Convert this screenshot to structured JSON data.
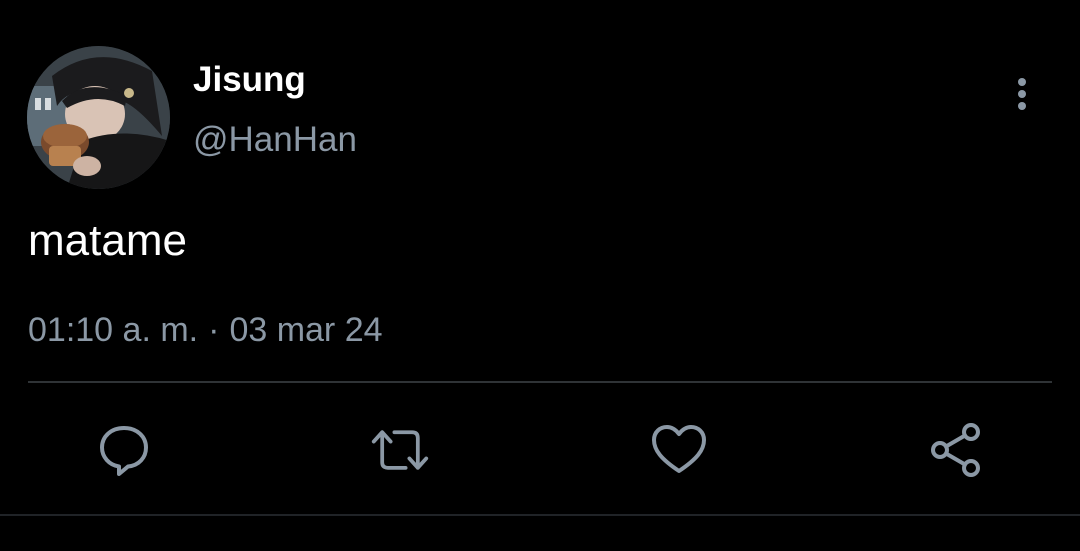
{
  "author": {
    "display_name": "Jisung",
    "handle": "@HanHan",
    "avatar_icon": "profile-photo"
  },
  "tweet": {
    "text": "matame",
    "time": "01:10 a. m.",
    "separator": "·",
    "date": "03 mar 24"
  },
  "actions": [
    {
      "name": "reply",
      "icon": "speech-bubble-icon"
    },
    {
      "name": "retweet",
      "icon": "retweet-arrows-icon"
    },
    {
      "name": "like",
      "icon": "heart-icon"
    },
    {
      "name": "share",
      "icon": "share-nodes-icon"
    }
  ],
  "more_menu": {
    "icon": "vertical-dots-icon"
  },
  "colors": {
    "background": "#000000",
    "primary_text": "#ffffff",
    "secondary_text": "#8b98a5",
    "divider": "#2f3336"
  }
}
